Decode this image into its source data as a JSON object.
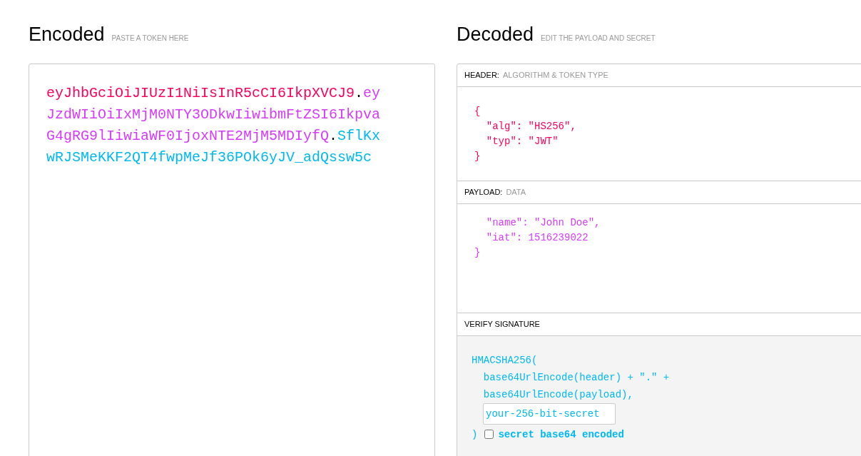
{
  "encoded": {
    "title": "Encoded",
    "subtitle": "PASTE A TOKEN HERE",
    "segments": [
      {
        "text": "eyJhbGciOiJIUzI1NiIsInR5cCI6IkpXVCJ9",
        "color": "#fb015b"
      },
      {
        "text": ".",
        "color": "#000000"
      },
      {
        "text": "eyJzdWIiOiIxMjM0NTY3ODkwIiwibmFtZSI6IkpvaG4gRG9lIiwiaWF0IjoxNTE2MjM5MDIyfQ",
        "color": "#d63aff"
      },
      {
        "text": ".",
        "color": "#000000"
      },
      {
        "text": "SflKxwRJSMeKKF2QT4fwpMeJf36POk6yJV_adQssw5c",
        "color": "#00b9f1"
      }
    ]
  },
  "decoded": {
    "title": "Decoded",
    "subtitle": "EDIT THE PAYLOAD AND SECRET",
    "sections": [
      {
        "kind": "code",
        "label": "HEADER:",
        "hint": "ALGORITHM & TOKEN TYPE",
        "color": "#fb015b",
        "lines": [
          "{",
          "  \"alg\": \"HS256\",",
          "  \"typ\": \"JWT\"",
          "}"
        ]
      },
      {
        "kind": "code",
        "label": "PAYLOAD:",
        "hint": "DATA",
        "color": "#d63aff",
        "lines": [
          "  \"name\": \"John Doe\",",
          "  \"iat\": 1516239022",
          "}"
        ]
      },
      {
        "kind": "signature",
        "label": "VERIFY SIGNATURE",
        "color": "#00b9f1",
        "lines": [
          "HMACSHA256(",
          "  base64UrlEncode(header) + \".\" +",
          "  base64UrlEncode(payload),"
        ],
        "secret": "your-256-bit-secret",
        "close": ")",
        "checkbox": {
          "label": "secret base64 encoded",
          "checked": false
        }
      }
    ]
  }
}
